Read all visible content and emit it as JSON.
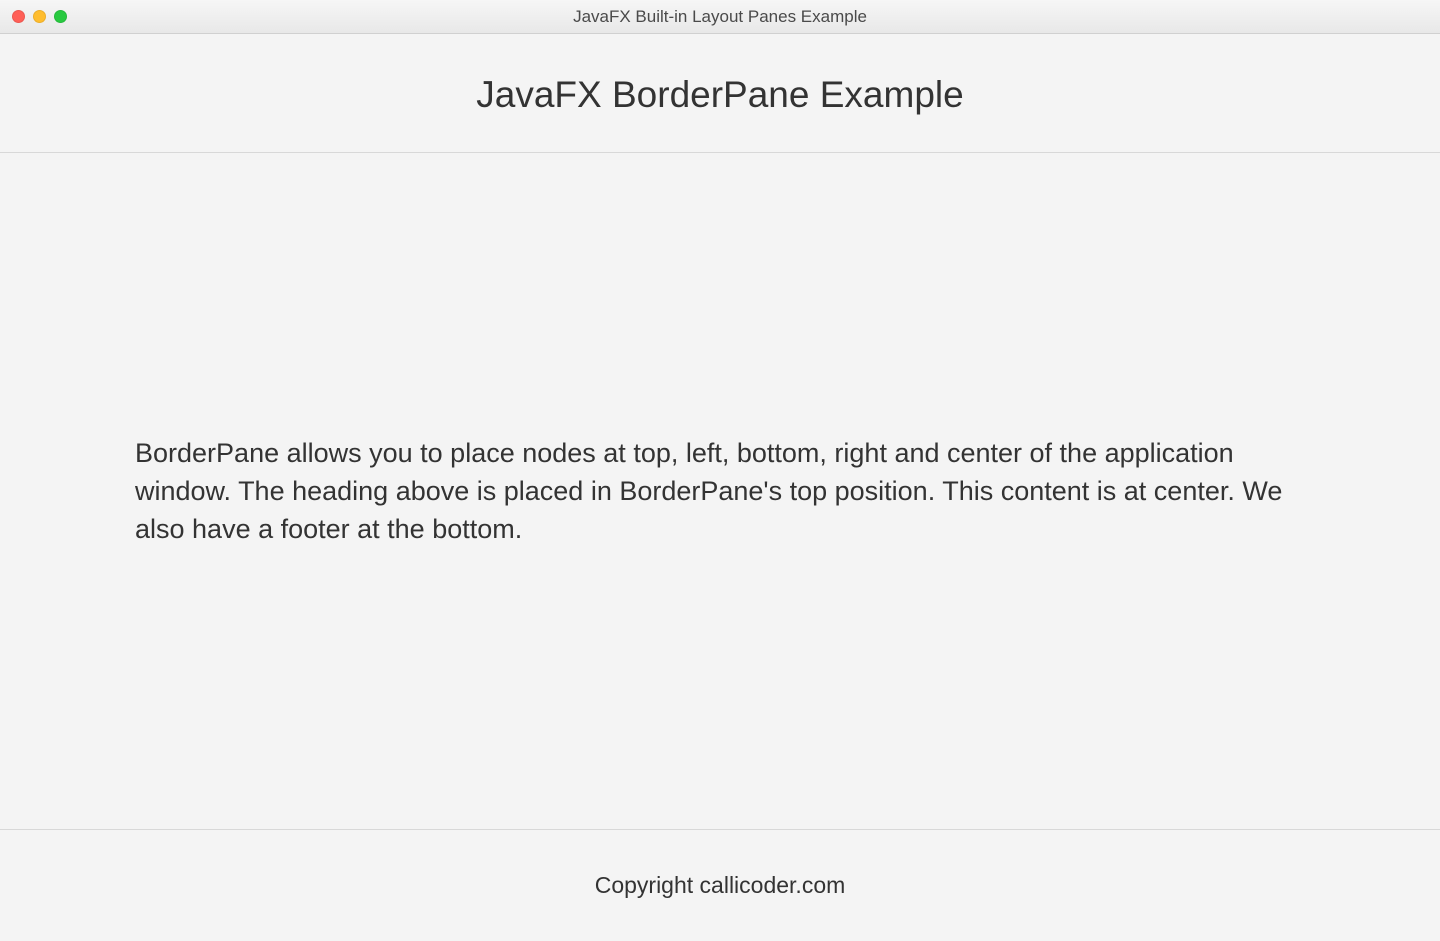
{
  "window": {
    "title": "JavaFX Built-in Layout Panes Example"
  },
  "top": {
    "heading": "JavaFX BorderPane Example"
  },
  "center": {
    "body": "BorderPane allows you to place nodes at top, left, bottom, right and center of the application window. The heading above is placed in BorderPane's top position. This content is at center. We also have a footer at the bottom."
  },
  "bottom": {
    "footer": "Copyright callicoder.com"
  }
}
